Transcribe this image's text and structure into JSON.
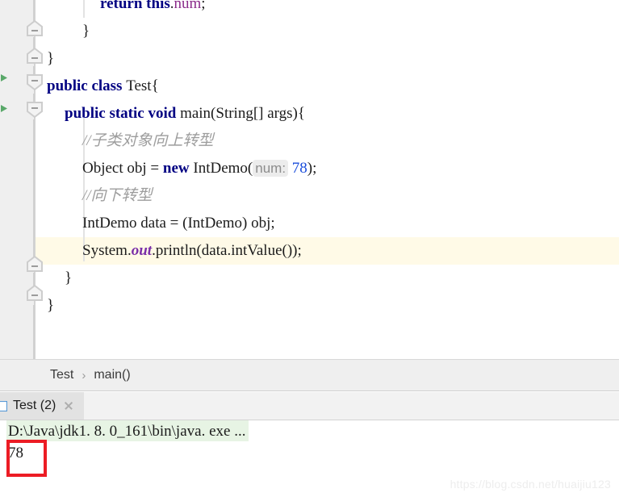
{
  "editor": {
    "lines": [
      {
        "indent": 3,
        "segments": [
          {
            "t": "return ",
            "c": "kw"
          },
          {
            "t": "this",
            "c": "kw"
          },
          {
            "t": ".",
            "c": "plain"
          },
          {
            "t": "num",
            "c": "field"
          },
          {
            "t": ";",
            "c": "plain"
          }
        ],
        "raw": "return this.num;"
      },
      {
        "indent": 2,
        "segments": [
          {
            "t": "}",
            "c": "plain"
          }
        ],
        "raw": "}"
      },
      {
        "indent": 0,
        "segments": [
          {
            "t": "}",
            "c": "plain"
          }
        ],
        "raw": "}"
      },
      {
        "indent": 0,
        "segments": [
          {
            "t": "public class ",
            "c": "kw"
          },
          {
            "t": "Test",
            "c": "plain"
          },
          {
            "t": "{",
            "c": "plain"
          }
        ],
        "raw": "public class Test{"
      },
      {
        "indent": 1,
        "segments": [
          {
            "t": "public static void ",
            "c": "kw"
          },
          {
            "t": "main(String[] args){",
            "c": "plain"
          }
        ],
        "raw": "public static void main(String[] args){"
      },
      {
        "indent": 2,
        "segments": [
          {
            "t": "//子类对象向上转型",
            "c": "cmt"
          }
        ],
        "raw": "//子类对象向上转型"
      },
      {
        "indent": 2,
        "segments": [
          {
            "t": "Object obj = ",
            "c": "plain"
          },
          {
            "t": "new ",
            "c": "kw"
          },
          {
            "t": "IntDemo(",
            "c": "plain"
          },
          {
            "t": "num:",
            "c": "hint"
          },
          {
            "t": " ",
            "c": "plain"
          },
          {
            "t": "78",
            "c": "num"
          },
          {
            "t": ");",
            "c": "plain"
          }
        ],
        "raw": "Object obj = new IntDemo( num: 78);"
      },
      {
        "indent": 2,
        "segments": [
          {
            "t": "//向下转型",
            "c": "cmt"
          }
        ],
        "raw": "//向下转型"
      },
      {
        "indent": 2,
        "segments": [
          {
            "t": "IntDemo data = (IntDemo) obj;",
            "c": "plain"
          }
        ],
        "raw": "IntDemo data = (IntDemo) obj;"
      },
      {
        "indent": 2,
        "segments": [
          {
            "t": "System.",
            "c": "plain"
          },
          {
            "t": "out",
            "c": "stat"
          },
          {
            "t": ".println(data.intValue());",
            "c": "plain"
          }
        ],
        "raw": "System.out.println(data.intValue());"
      },
      {
        "indent": 1,
        "segments": [
          {
            "t": "}",
            "c": "plain"
          }
        ],
        "raw": "}"
      },
      {
        "indent": 0,
        "segments": [
          {
            "t": "}",
            "c": "plain"
          }
        ],
        "raw": "}"
      }
    ],
    "caret_line_index": 9,
    "parameter_hint": "num:",
    "gutter": {
      "fold_markers": [
        "collapse-fold-icon",
        "collapse-fold-icon",
        "expand-fold-icon",
        "expand-fold-icon",
        "collapse-fold-icon",
        "collapse-fold-icon"
      ],
      "run_markers": [
        "run-class-gutter-icon",
        "run-method-gutter-icon"
      ]
    }
  },
  "breadcrumb": {
    "items": [
      "Test",
      "main()"
    ],
    "separator": "›"
  },
  "run_window": {
    "tab_label": "Test (2)",
    "close_label": "×",
    "console": {
      "command_line": "D:\\Java\\jdk1. 8. 0_161\\bin\\java. exe ...",
      "output_line": "78"
    }
  },
  "watermark": "https://blog.csdn.net/huaijiu123",
  "colors": {
    "keyword": "#000082",
    "field": "#8a2b8a",
    "number": "#1a4ddb",
    "comment": "#9d9d9d",
    "static_field": "#7a2ea8",
    "caret_row": "#fffae7",
    "gutter": "#efefef",
    "console_cmd_bg": "#e7f4e4",
    "highlight_box": "#ec1c24"
  }
}
